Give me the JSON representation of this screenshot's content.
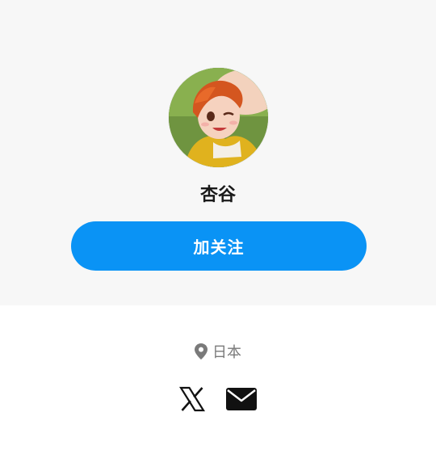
{
  "profile": {
    "name": "杏谷",
    "avatar_icon": "anime-avatar",
    "follow_label": "加关注",
    "location": "日本"
  },
  "social": [
    {
      "icon": "x-logo-icon"
    },
    {
      "icon": "mail-icon"
    }
  ],
  "colors": {
    "accent": "#0a93f5",
    "header_bg": "#f7f7f7",
    "muted_text": "#7a7a7a",
    "name_text": "#1a1a1a"
  }
}
